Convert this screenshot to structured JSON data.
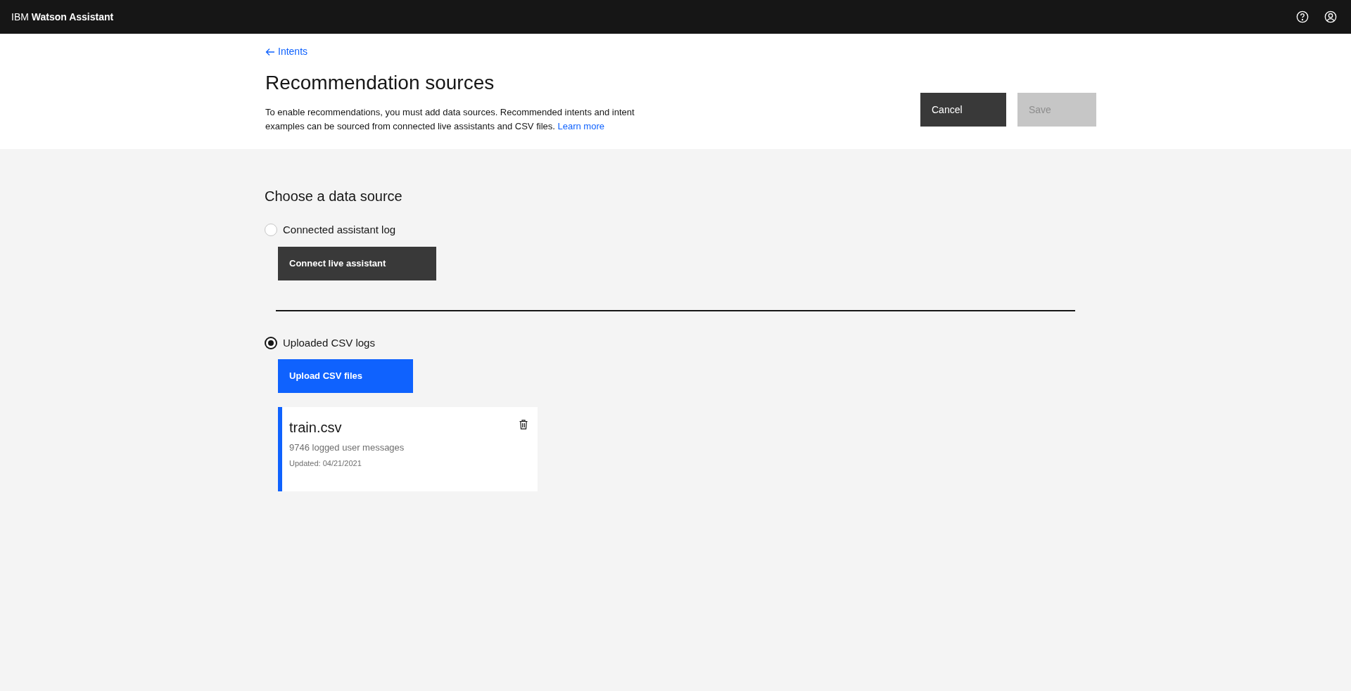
{
  "header": {
    "product_name": "IBM **Watson Assistant**"
  },
  "page": {
    "back_link": "Intents",
    "title": "Recommendation sources",
    "description": "To enable recommendations, you must add data sources. Recommended intents and intent examples can be sourced from connected live assistants and CSV files.",
    "learn_more": "Learn more",
    "buttons": [
      {
        "label": "Cancel",
        "disabled": false
      },
      {
        "label": "Save",
        "disabled": true
      }
    ]
  },
  "section": {
    "title": "Choose a data source",
    "sources": [
      {
        "label": "Connected assistant log",
        "selected": false,
        "button": {
          "label": "Connect live assistant",
          "kind": "secondary"
        }
      },
      {
        "label": "Uploaded CSV logs",
        "selected": true,
        "button": {
          "label": "Upload CSV files",
          "kind": "primary"
        },
        "files": [
          {
            "name": "train.csv",
            "messages": "9746 logged user messages",
            "updated": "Updated: 04/21/2021"
          }
        ]
      }
    ]
  }
}
